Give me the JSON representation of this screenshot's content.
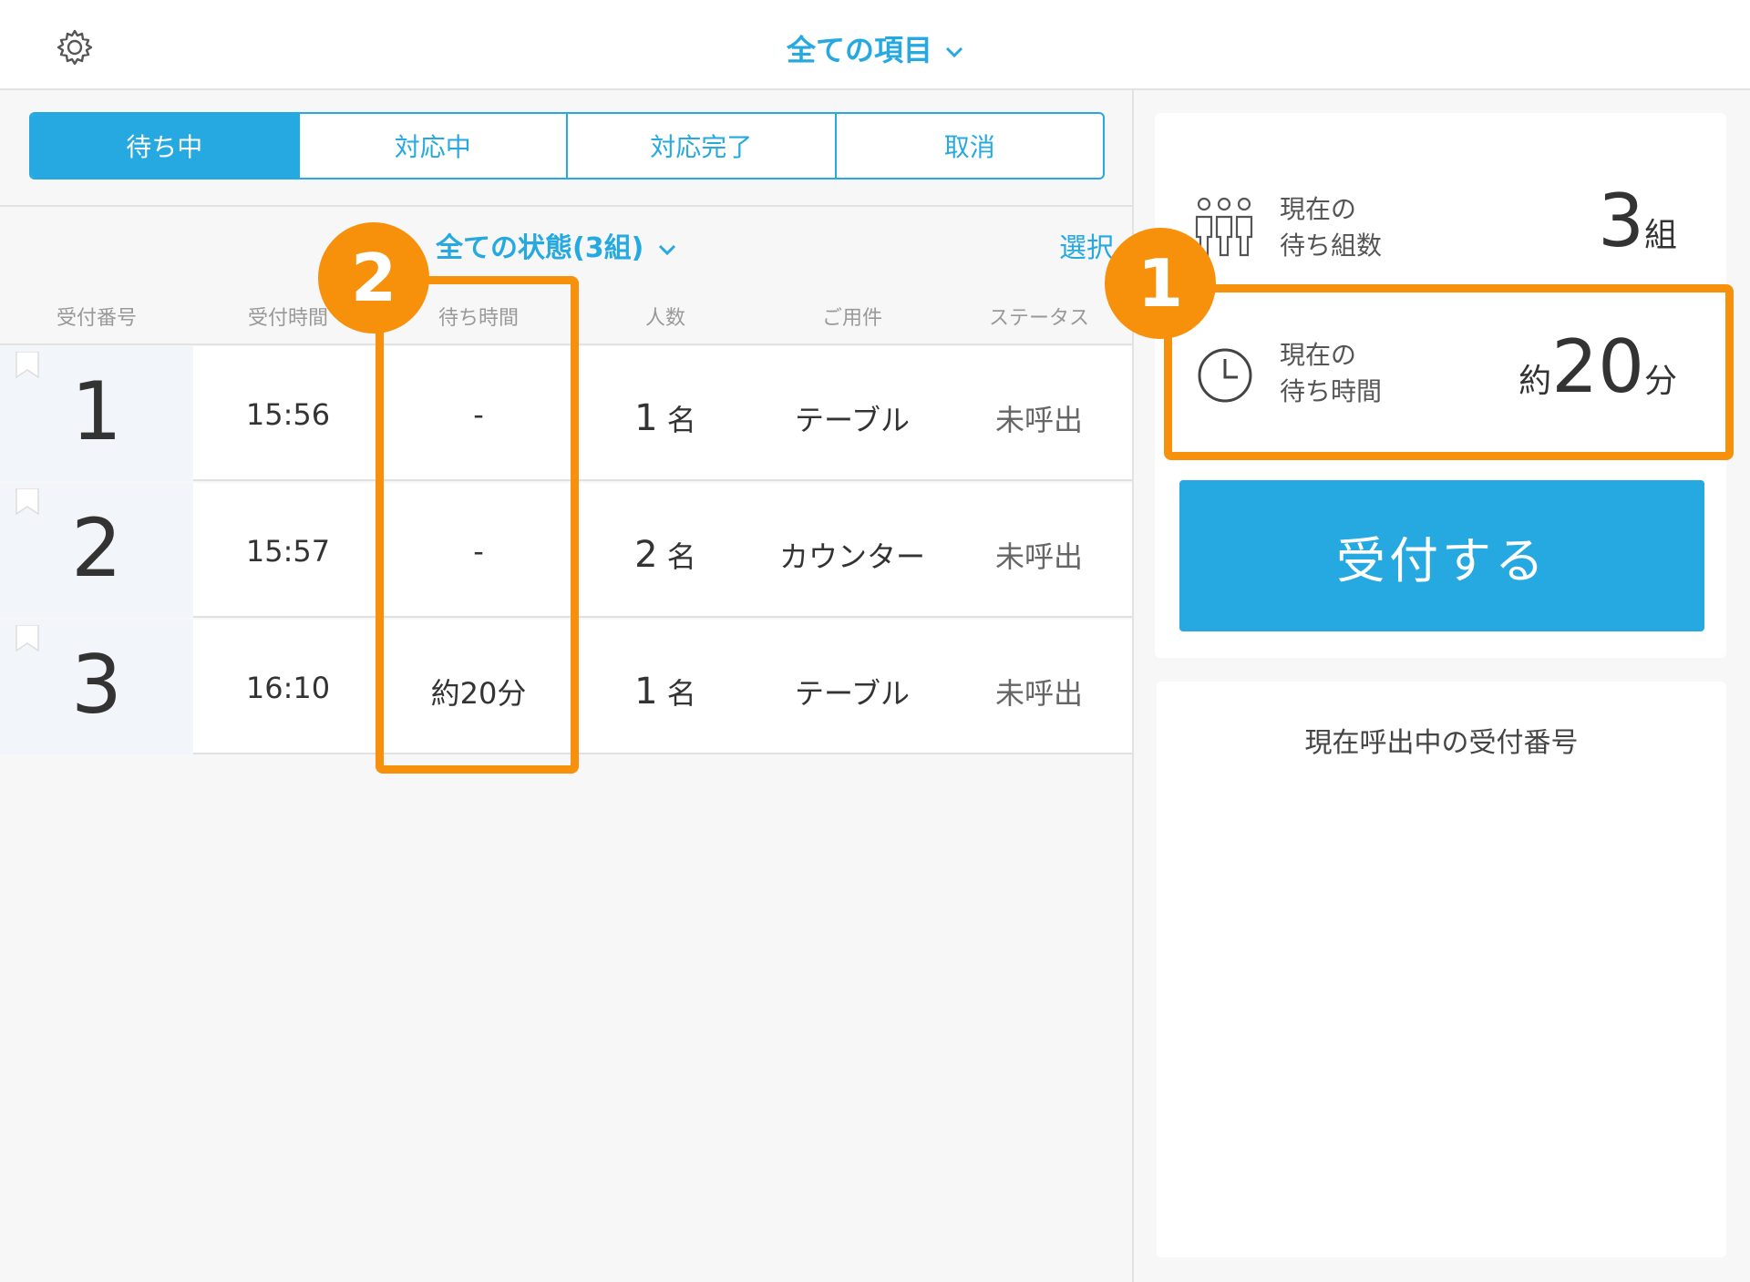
{
  "header": {
    "title": "全ての項目",
    "settings_icon": "gear-icon",
    "title_icon": "chevron-down-icon"
  },
  "tabs": [
    {
      "label": "待ち中",
      "active": true
    },
    {
      "label": "対応中",
      "active": false
    },
    {
      "label": "対応完了",
      "active": false
    },
    {
      "label": "取消",
      "active": false
    }
  ],
  "filter": {
    "label": "全ての状態(3組)",
    "select_label": "選択"
  },
  "table": {
    "columns": [
      "受付番号",
      "受付時間",
      "待ち時間",
      "人数",
      "ご用件",
      "ステータス"
    ],
    "rows": [
      {
        "number": "1",
        "time": "15:56",
        "wait": "-",
        "people": "1",
        "people_unit": "名",
        "purpose": "テーブル",
        "status": "未呼出"
      },
      {
        "number": "2",
        "time": "15:57",
        "wait": "-",
        "people": "2",
        "people_unit": "名",
        "purpose": "カウンター",
        "status": "未呼出"
      },
      {
        "number": "3",
        "time": "16:10",
        "wait": "約20分",
        "people": "1",
        "people_unit": "名",
        "purpose": "テーブル",
        "status": "未呼出"
      }
    ]
  },
  "stats": {
    "groups": {
      "label_line1": "現在の",
      "label_line2": "待ち組数",
      "value": "3",
      "unit": "組",
      "icon": "people-group-icon"
    },
    "wait": {
      "label_line1": "現在の",
      "label_line2": "待ち時間",
      "prefix": "約",
      "value": "20",
      "unit": "分",
      "icon": "clock-icon"
    }
  },
  "accept_button": {
    "label": "受付する"
  },
  "calling": {
    "title": "現在呼出中の受付番号"
  },
  "annotations": {
    "badge1": "1",
    "badge2": "2",
    "color": "#f7910b"
  },
  "colors": {
    "accent": "#25a9e0"
  }
}
